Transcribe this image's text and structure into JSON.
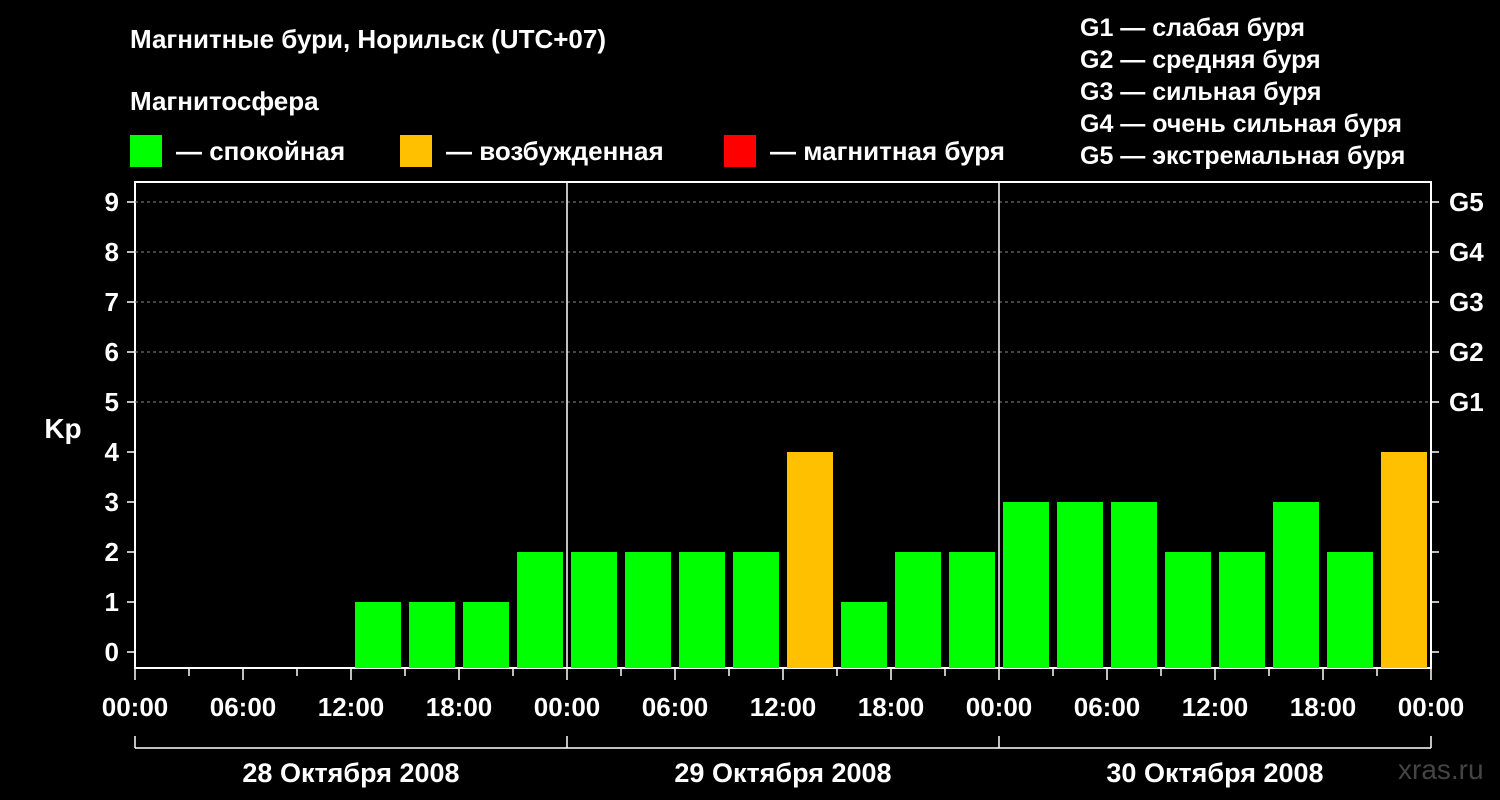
{
  "title": "Магнитные бури, Норильск (UTC+07)",
  "subtitle": "Магнитосфера",
  "legend": [
    {
      "label": "— спокойная",
      "color": "#00ff00"
    },
    {
      "label": "— возбужденная",
      "color": "#ffc000"
    },
    {
      "label": "— магнитная буря",
      "color": "#ff0000"
    }
  ],
  "g_levels": [
    "G1 — слабая буря",
    "G2 — средняя буря",
    "G3 — сильная буря",
    "G4 — очень сильная буря",
    "G5 — экстремальная буря"
  ],
  "watermark": "xras.ru",
  "chart_data": {
    "type": "bar",
    "ylabel": "Kp",
    "ylim": [
      0,
      9
    ],
    "yticks": [
      0,
      1,
      2,
      3,
      4,
      5,
      6,
      7,
      8,
      9
    ],
    "right_ticks": [
      {
        "y": 5,
        "label": "G1"
      },
      {
        "y": 6,
        "label": "G2"
      },
      {
        "y": 7,
        "label": "G3"
      },
      {
        "y": 8,
        "label": "G4"
      },
      {
        "y": 9,
        "label": "G5"
      }
    ],
    "xtick_labels": [
      "00:00",
      "06:00",
      "12:00",
      "18:00",
      "00:00",
      "06:00",
      "12:00",
      "18:00",
      "00:00",
      "06:00",
      "12:00",
      "18:00",
      "00:00"
    ],
    "days": [
      "28 Октября 2008",
      "29 Октября 2008",
      "30 Октября 2008"
    ],
    "categories": [
      "28 00:00",
      "28 03:00",
      "28 06:00",
      "28 09:00",
      "28 12:00",
      "28 15:00",
      "28 18:00",
      "28 21:00",
      "29 00:00",
      "29 03:00",
      "29 06:00",
      "29 09:00",
      "29 12:00",
      "29 15:00",
      "29 18:00",
      "29 21:00",
      "30 00:00",
      "30 03:00",
      "30 06:00",
      "30 09:00",
      "30 12:00",
      "30 15:00",
      "30 18:00",
      "30 21:00"
    ],
    "values": [
      null,
      null,
      null,
      null,
      1,
      1,
      1,
      2,
      2,
      2,
      2,
      2,
      4,
      1,
      2,
      2,
      3,
      3,
      3,
      2,
      2,
      3,
      2,
      4
    ],
    "colors": {
      "quiet": "#00ff00",
      "active": "#ffc000",
      "storm": "#ff0000"
    },
    "grid": true
  }
}
